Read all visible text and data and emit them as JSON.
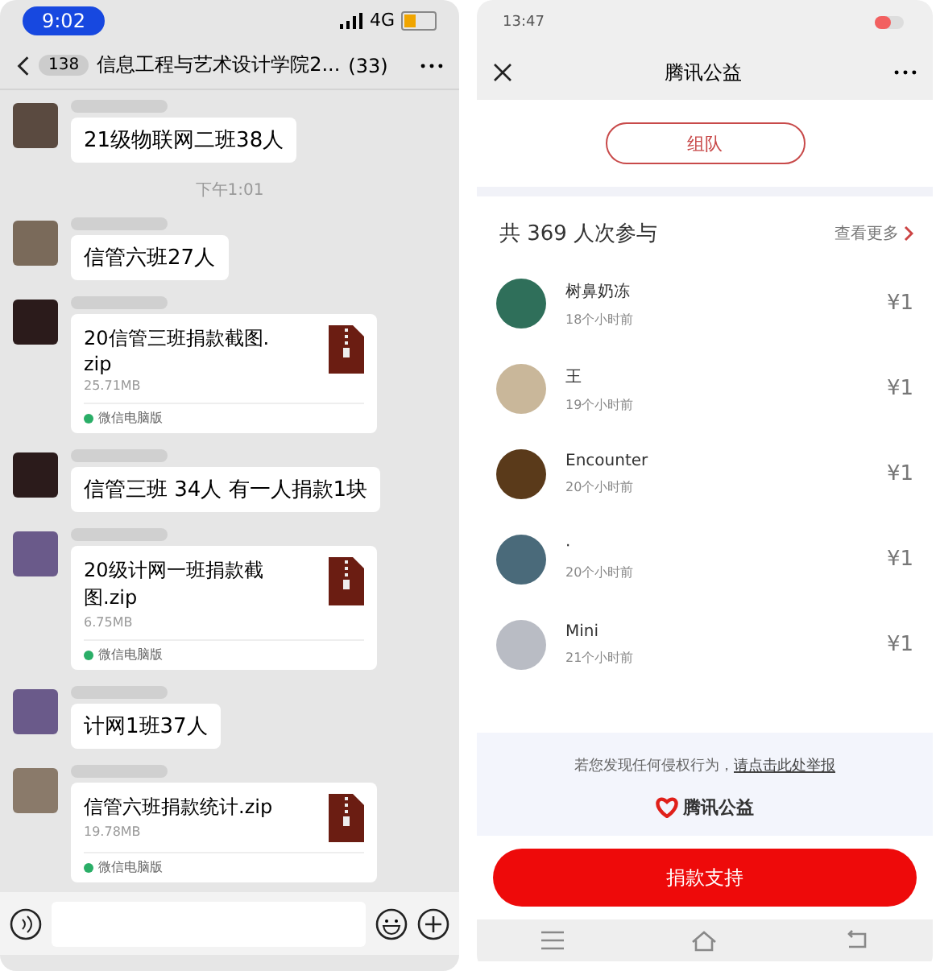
{
  "chat": {
    "status_bar": {
      "time": "9:02",
      "network": "4G"
    },
    "header": {
      "back_badge": "138",
      "title": "信息工程与艺术设计学院2...",
      "member_count": "(33)"
    },
    "messages": [
      {
        "kind": "text",
        "text": "21级物联网二班38人"
      },
      {
        "kind": "time",
        "text": "下午1:01"
      },
      {
        "kind": "text",
        "text": "信管六班27人"
      },
      {
        "kind": "file",
        "name": "20信管三班捐款截图.zip",
        "size": "25.71MB",
        "source": "微信电脑版"
      },
      {
        "kind": "text",
        "text": "信管三班 34人  有一人捐款1块"
      },
      {
        "kind": "file",
        "name": "20级计网一班捐款截图.zip",
        "size": "6.75MB",
        "source": "微信电脑版"
      },
      {
        "kind": "text",
        "text": "计网1班37人"
      },
      {
        "kind": "file",
        "name": "信管六班捐款统计.zip",
        "size": "19.78MB",
        "source": "微信电脑版"
      }
    ]
  },
  "charity": {
    "status_bar": {
      "time": "13:47"
    },
    "header": {
      "title": "腾讯公益"
    },
    "team_button": "组队",
    "participants": {
      "summary": "共 369 人次参与",
      "more_link": "查看更多"
    },
    "donors": [
      {
        "name": "树鼻奶冻",
        "time": "18个小时前",
        "amount": "¥1"
      },
      {
        "name": "王",
        "time": "19个小时前",
        "amount": "¥1"
      },
      {
        "name": "Encounter",
        "time": "20个小时前",
        "amount": "¥1"
      },
      {
        "name": "·",
        "time": "20个小时前",
        "amount": "¥1"
      },
      {
        "name": "Mini",
        "time": "21个小时前",
        "amount": "¥1"
      }
    ],
    "report": {
      "text": "若您发现任何侵权行为，",
      "link": "请点击此处举报"
    },
    "logo_text": "腾讯公益",
    "donate_button": "捐款支持"
  }
}
